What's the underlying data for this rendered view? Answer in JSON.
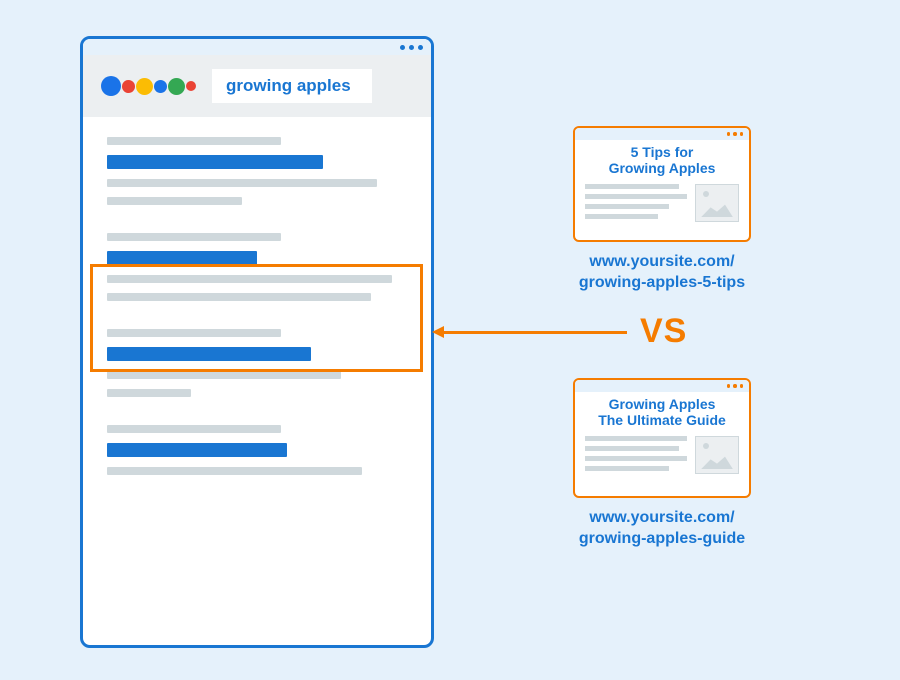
{
  "search": {
    "query": "growing apples"
  },
  "cards": {
    "top": {
      "title_line1": "5 Tips for",
      "title_line2": "Growing Apples",
      "url_line1": "www.yoursite.com/",
      "url_line2": "growing-apples-5-tips"
    },
    "bottom": {
      "title_line1": "Growing Apples",
      "title_line2": "The Ultimate Guide",
      "url_line1": "www.yoursite.com/",
      "url_line2": "growing-apples-guide"
    }
  },
  "vs_label": "VS"
}
